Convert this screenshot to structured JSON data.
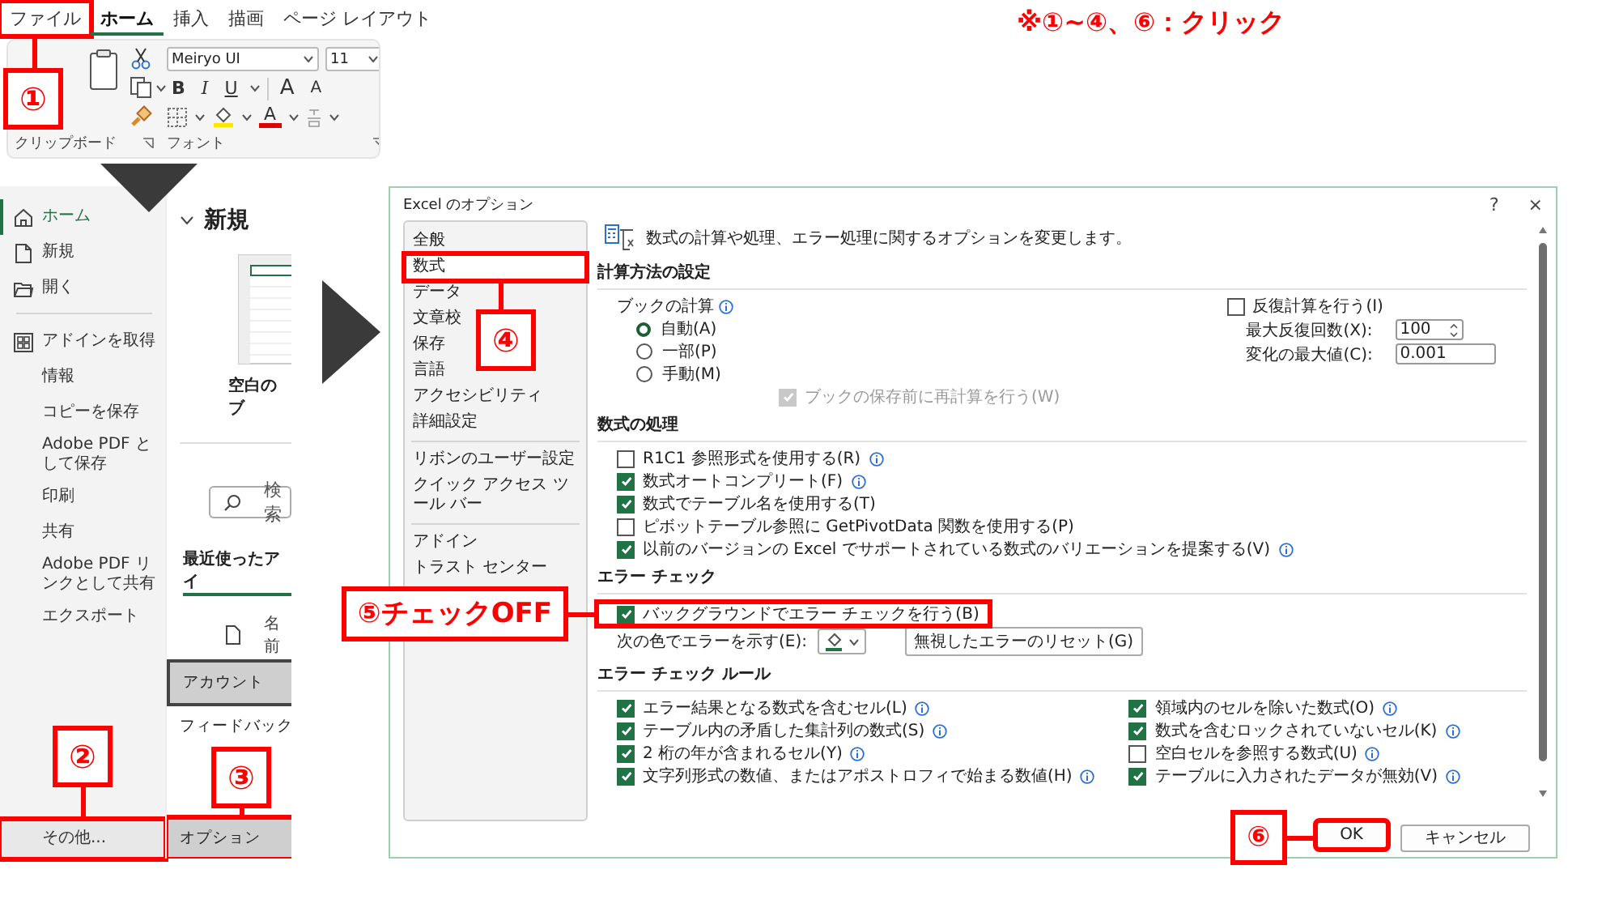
{
  "note": "※①~④、⑥：クリック",
  "ribbon": {
    "tabs": [
      {
        "label": "ファイル",
        "selected": false,
        "highlighted": true,
        "callout": "①"
      },
      {
        "label": "ホーム",
        "selected": true,
        "highlighted": false
      },
      {
        "label": "挿入",
        "selected": false,
        "highlighted": false
      },
      {
        "label": "描画",
        "selected": false,
        "highlighted": false
      },
      {
        "label": "ページ レイアウト",
        "selected": false,
        "highlighted": false
      }
    ],
    "font_name": "Meiryo UI",
    "font_size": "11",
    "style_buttons": [
      "B",
      "I",
      "U"
    ],
    "grow_button": "A",
    "shrink_button": "A",
    "font_color_button": "A",
    "groups": [
      "クリップボード",
      "フォント"
    ]
  },
  "backstage": {
    "nav": [
      {
        "kind": "home",
        "label": "ホーム",
        "selected": true,
        "highlighted": false
      },
      {
        "kind": "new",
        "label": "新規",
        "selected": false,
        "highlighted": false
      },
      {
        "kind": "open",
        "label": "開く",
        "selected": false,
        "highlighted": false
      },
      {
        "kind": "divider"
      },
      {
        "kind": "addins",
        "label": "アドインを取得",
        "selected": false,
        "highlighted": false
      },
      {
        "kind": "command",
        "label": "情報",
        "selected": false,
        "highlighted": false
      },
      {
        "kind": "command",
        "label": "コピーを保存",
        "selected": false,
        "highlighted": false
      },
      {
        "kind": "command",
        "label": "Adobe PDF として保存",
        "selected": false,
        "highlighted": false
      },
      {
        "kind": "command",
        "label": "印刷",
        "selected": false,
        "highlighted": false
      },
      {
        "kind": "command",
        "label": "共有",
        "selected": false,
        "highlighted": false
      },
      {
        "kind": "command",
        "label": "Adobe PDF リンクとして共有",
        "selected": false,
        "highlighted": false
      },
      {
        "kind": "command",
        "label": "エクスポート",
        "selected": false,
        "highlighted": false
      },
      {
        "kind": "more",
        "label": "その他...",
        "selected": false,
        "highlighted": true,
        "callout": "②"
      }
    ],
    "heading": "新規",
    "template_caption": "空白のブ",
    "search_placeholder": "検索",
    "recent_tab": "最近使ったアイ",
    "name_column": "名前",
    "popup": [
      {
        "label": "アカウント",
        "selected": true,
        "highlighted": false
      },
      {
        "label": "フィードバック",
        "selected": false,
        "highlighted": false
      },
      {
        "label": "オプション",
        "selected": false,
        "highlighted": true,
        "callout": "③"
      }
    ]
  },
  "dialog": {
    "title": "Excel のオプション",
    "help": "?",
    "close": "×",
    "categories": [
      {
        "kind": "item",
        "label": "全般",
        "selected": false,
        "highlighted": false
      },
      {
        "kind": "item",
        "label": "数式",
        "selected": true,
        "highlighted": true,
        "callout": "④"
      },
      {
        "kind": "item",
        "label": "データ",
        "selected": false,
        "highlighted": false
      },
      {
        "kind": "item",
        "label": "文章校",
        "selected": false,
        "highlighted": false
      },
      {
        "kind": "item",
        "label": "保存",
        "selected": false,
        "highlighted": false
      },
      {
        "kind": "item",
        "label": "言語",
        "selected": false,
        "highlighted": false
      },
      {
        "kind": "item",
        "label": "アクセシビリティ",
        "selected": false,
        "highlighted": false
      },
      {
        "kind": "item",
        "label": "詳細設定",
        "selected": false,
        "highlighted": false
      },
      {
        "kind": "divider"
      },
      {
        "kind": "item",
        "label": "リボンのユーザー設定",
        "selected": false,
        "highlighted": false
      },
      {
        "kind": "item",
        "label": "クイック アクセス ツール バー",
        "selected": false,
        "highlighted": false
      },
      {
        "kind": "divider"
      },
      {
        "kind": "item",
        "label": "アドイン",
        "selected": false,
        "highlighted": false
      },
      {
        "kind": "item",
        "label": "トラスト センター",
        "selected": false,
        "highlighted": false
      }
    ],
    "intro": "数式の計算や処理、エラー処理に関するオプションを変更します。",
    "calculation": {
      "title": "計算方法の設定",
      "workbook_label": "ブックの計算",
      "modes": [
        {
          "label": "自動(A)",
          "selected": true
        },
        {
          "label": "一部(P)",
          "selected": false
        },
        {
          "label": "手動(M)",
          "selected": false
        }
      ],
      "recalc_before_save": {
        "label": "ブックの保存前に再計算を行う(W)",
        "checked": true,
        "disabled": true
      },
      "iterative": {
        "label": "反復計算を行う(I)",
        "checked": false
      },
      "max_iterations": {
        "label": "最大反復回数(X):",
        "value": "100"
      },
      "max_change": {
        "label": "変化の最大値(C):",
        "value": "0.001"
      }
    },
    "formulas": {
      "title": "数式の処理",
      "options": [
        {
          "label": "R1C1 参照形式を使用する(R)",
          "checked": false,
          "info": true
        },
        {
          "label": "数式オートコンプリート(F)",
          "checked": true,
          "info": true
        },
        {
          "label": "数式でテーブル名を使用する(T)",
          "checked": true,
          "info": false
        },
        {
          "label": "ピボットテーブル参照に GetPivotData 関数を使用する(P)",
          "checked": false,
          "info": false
        },
        {
          "label": "以前のバージョンの Excel でサポートされている数式のバリエーションを提案する(V)",
          "checked": true,
          "info": true
        }
      ]
    },
    "error_checking": {
      "title": "エラー チェック",
      "background": {
        "label": "バックグラウンドでエラー チェックを行う(B)",
        "checked": true,
        "highlighted": true,
        "callout": "⑤チェックOFF"
      },
      "reset_button": "無視したエラーのリセット(G)",
      "color_label": "次の色でエラーを示す(E):"
    },
    "rules": {
      "title": "エラー チェック ルール",
      "options": [
        {
          "label": "エラー結果となる数式を含むセル(L)",
          "checked": true,
          "info": true
        },
        {
          "label": "テーブル内の矛盾した集計列の数式(S)",
          "checked": true,
          "info": true
        },
        {
          "label": "2 桁の年が含まれるセル(Y)",
          "checked": true,
          "info": true
        },
        {
          "label": "文字列形式の数値、またはアポストロフィで始まる数値(H)",
          "checked": true,
          "info": true
        },
        {
          "label": "領域内のセルを除いた数式(O)",
          "checked": true,
          "info": true
        },
        {
          "label": "数式を含むロックされていないセル(K)",
          "checked": true,
          "info": true
        },
        {
          "label": "空白セルを参照する数式(U)",
          "checked": false,
          "info": true
        },
        {
          "label": "テーブルに入力されたデータが無効(V)",
          "checked": true,
          "info": true
        }
      ]
    },
    "buttons": [
      {
        "label": "OK",
        "highlighted": true,
        "callout": "⑥"
      },
      {
        "label": "キャンセル",
        "highlighted": false
      }
    ]
  }
}
